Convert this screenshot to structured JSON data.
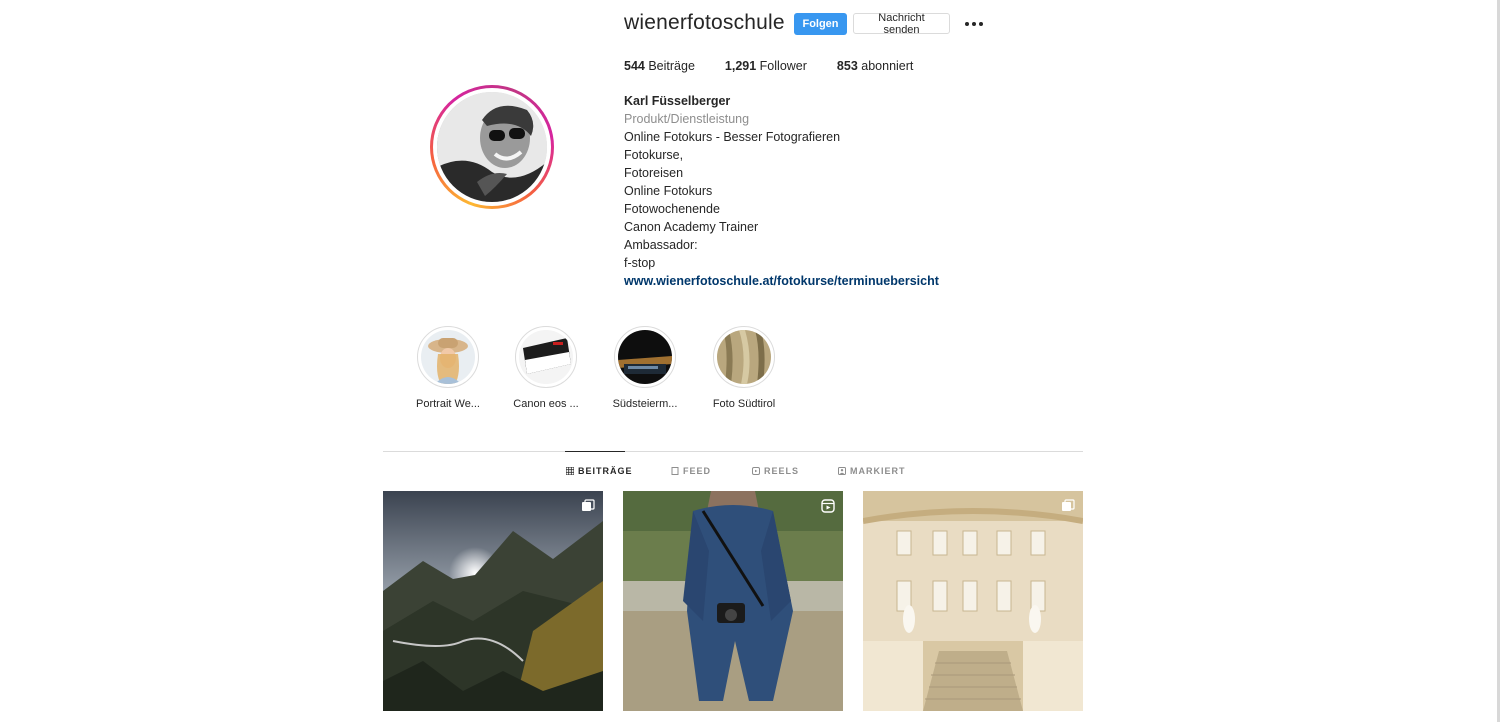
{
  "profile": {
    "username": "wienerfotoschule",
    "follow_label": "Folgen",
    "message_label": "Nachricht senden",
    "more_icon": "more-horizontal-icon"
  },
  "stats": {
    "posts_count": "544",
    "posts_label": "Beiträge",
    "followers_count": "1,291",
    "followers_label": "Follower",
    "following_count": "853",
    "following_label": "abonniert"
  },
  "bio": {
    "name": "Karl Füsselberger",
    "category": "Produkt/Dienstleistung",
    "lines": [
      "Online Fotokurs - Besser Fotografieren",
      "Fotokurse,",
      "Fotoreisen",
      "Online Fotokurs",
      "Fotowochenende",
      "Canon Academy Trainer",
      "Ambassador:",
      "f-stop"
    ],
    "link": "www.wienerfotoschule.at/fotokurse/terminuebersicht"
  },
  "highlights": [
    {
      "label": "Portrait We..."
    },
    {
      "label": "Canon eos ..."
    },
    {
      "label": "Südsteierm..."
    },
    {
      "label": "Foto Südtirol"
    }
  ],
  "tabs": [
    {
      "label": "BEITRÄGE",
      "icon": "grid-icon"
    },
    {
      "label": "FEED",
      "icon": "feed-icon"
    },
    {
      "label": "REELS",
      "icon": "reels-icon"
    },
    {
      "label": "MARKIERT",
      "icon": "tagged-icon"
    }
  ],
  "posts": [
    {
      "subject": "mountain valley",
      "badge": "carousel-icon"
    },
    {
      "subject": "man with camera",
      "badge": "reel-icon"
    },
    {
      "subject": "palace staircase",
      "badge": "carousel-icon"
    }
  ],
  "colors": {
    "accent": "#3897f0",
    "link": "#00376b",
    "muted": "#8e8e8e",
    "text": "#262626",
    "border": "#dbdbdb"
  }
}
